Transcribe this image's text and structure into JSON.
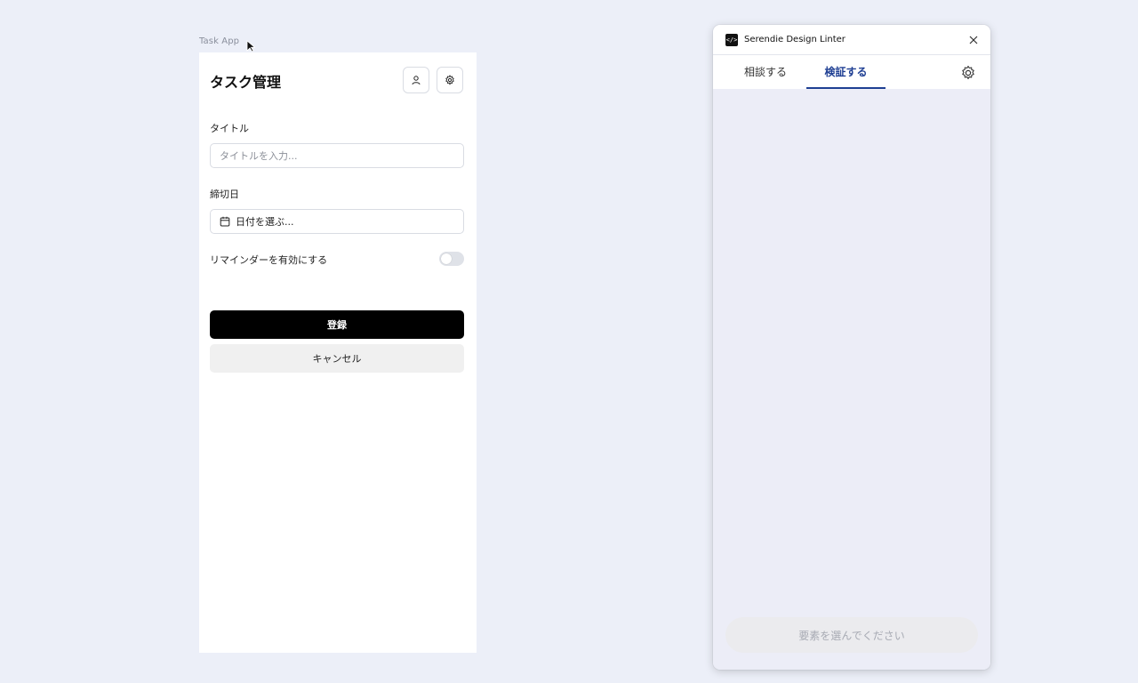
{
  "canvas": {
    "frame_label": "Task App"
  },
  "task_app": {
    "title": "タスク管理",
    "title_field": {
      "label": "タイトル",
      "placeholder": "タイトルを入力..."
    },
    "due_field": {
      "label": "締切日",
      "value": "日付を選ぶ..."
    },
    "reminder": {
      "label": "リマインダーを有効にする",
      "enabled": false
    },
    "buttons": {
      "submit": "登録",
      "cancel": "キャンセル"
    },
    "icons": {
      "user": "user-icon",
      "settings": "gear-icon",
      "calendar": "calendar-icon"
    }
  },
  "plugin": {
    "title": "Serendie Design Linter",
    "logo_text": "</>",
    "tabs": [
      {
        "label": "相談する",
        "active": false
      },
      {
        "label": "検証する",
        "active": true
      }
    ],
    "action_button": "要素を選んでください",
    "colors": {
      "accent": "#1f3f93",
      "disabled_text": "#a8abb4"
    }
  }
}
